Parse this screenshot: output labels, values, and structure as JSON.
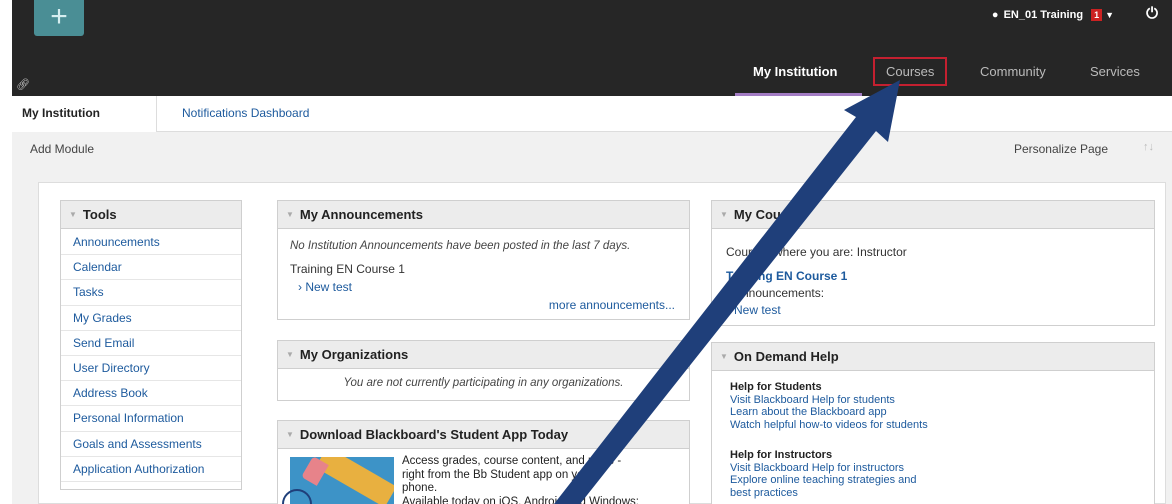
{
  "topbar": {
    "add_icon": "plus-icon",
    "user_name": "EN_01 Training",
    "notification_count": "1",
    "tabs": [
      {
        "label": "My Institution"
      },
      {
        "label": "Courses"
      },
      {
        "label": "Community"
      },
      {
        "label": "Services"
      }
    ]
  },
  "subnav": {
    "tabs": [
      {
        "label": "My Institution"
      },
      {
        "label": "Notifications Dashboard"
      }
    ]
  },
  "toolbar": {
    "add_module_label": "Add Module",
    "personalize_label": "Personalize Page"
  },
  "modules": {
    "tools": {
      "title": "Tools",
      "items": [
        {
          "label": "Announcements"
        },
        {
          "label": "Calendar"
        },
        {
          "label": "Tasks"
        },
        {
          "label": "My Grades"
        },
        {
          "label": "Send Email"
        },
        {
          "label": "User Directory"
        },
        {
          "label": "Address Book"
        },
        {
          "label": "Personal Information"
        },
        {
          "label": "Goals and Assessments"
        },
        {
          "label": "Application Authorization"
        }
      ]
    },
    "announcements": {
      "title": "My Announcements",
      "empty_text": "No Institution Announcements have been posted in the last 7 days.",
      "course": "Training EN Course 1",
      "item": "› New test",
      "more_link": "more announcements..."
    },
    "organizations": {
      "title": "My Organizations",
      "empty_text": "You are not currently participating in any organizations."
    },
    "app": {
      "title": "Download Blackboard's Student App Today",
      "line1": "Access grades, course content, and more -",
      "line2": "right from the Bb Student app on your",
      "line3": "phone.",
      "line4": "Available today on iOS, Android and Windows:"
    },
    "courses": {
      "title": "My Courses",
      "role_text": "Courses where you are: Instructor",
      "course_link": "Training EN Course 1",
      "ann_label": "Announcements:",
      "ann_item": "New test"
    },
    "help": {
      "title": "On Demand Help",
      "students_title": "Help for Students",
      "students_links": [
        {
          "label": "Visit Blackboard Help for students"
        },
        {
          "label": "Learn about the Blackboard app"
        },
        {
          "label": "Watch helpful how-to videos for students"
        }
      ],
      "instructors_title": "Help for Instructors",
      "instructors_links": [
        {
          "label": "Visit Blackboard Help for instructors"
        },
        {
          "label": "Explore online teaching strategies and"
        },
        {
          "label": "best practices"
        }
      ]
    }
  },
  "colors": {
    "topbar": "#262626",
    "link": "#1d5a9d",
    "highlight_outline": "#c42030",
    "active_tab_underline": "#a37cc4",
    "annotation_arrow": "#1f3f7a"
  }
}
